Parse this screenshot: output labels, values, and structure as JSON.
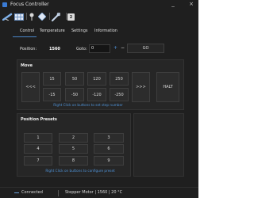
{
  "window": {
    "title": "Focus Controller",
    "minimize": "_",
    "close": "×"
  },
  "toolbar": {
    "items": [
      {
        "name": "telescope-icon"
      },
      {
        "name": "grid-icon"
      },
      {
        "name": "pin-icon"
      },
      {
        "name": "diamond-icon"
      },
      {
        "name": "wrench-icon"
      },
      {
        "name": "number-badge",
        "label": "2"
      }
    ]
  },
  "menu": {
    "items": [
      "Control",
      "Temperature",
      "Settings",
      "Information"
    ],
    "active": "Control"
  },
  "position": {
    "label": "Position:",
    "value": "1560",
    "goto_label": "Goto:",
    "goto_value": "0",
    "plus": "+",
    "minus": "−",
    "go_label": "GO"
  },
  "move": {
    "title": "Move",
    "left_label": "<<<",
    "right_label": ">>>",
    "halt_label": "HALT",
    "row1": [
      "15",
      "50",
      "120",
      "250"
    ],
    "row2": [
      "-15",
      "-50",
      "-120",
      "-250"
    ],
    "hint": "Right Click on buttons to set step number"
  },
  "presets": {
    "title": "Position Presets",
    "buttons": [
      "1",
      "2",
      "3",
      "4",
      "5",
      "6",
      "7",
      "8",
      "9"
    ],
    "hint": "Right Click on buttons to configure preset"
  },
  "status": {
    "connection": "Connected",
    "info": "Stepper Motor | 1560 | 20 °C"
  },
  "colors": {
    "background": "#1f1f1f",
    "panel": "#262626",
    "accent": "#4f93d8"
  }
}
